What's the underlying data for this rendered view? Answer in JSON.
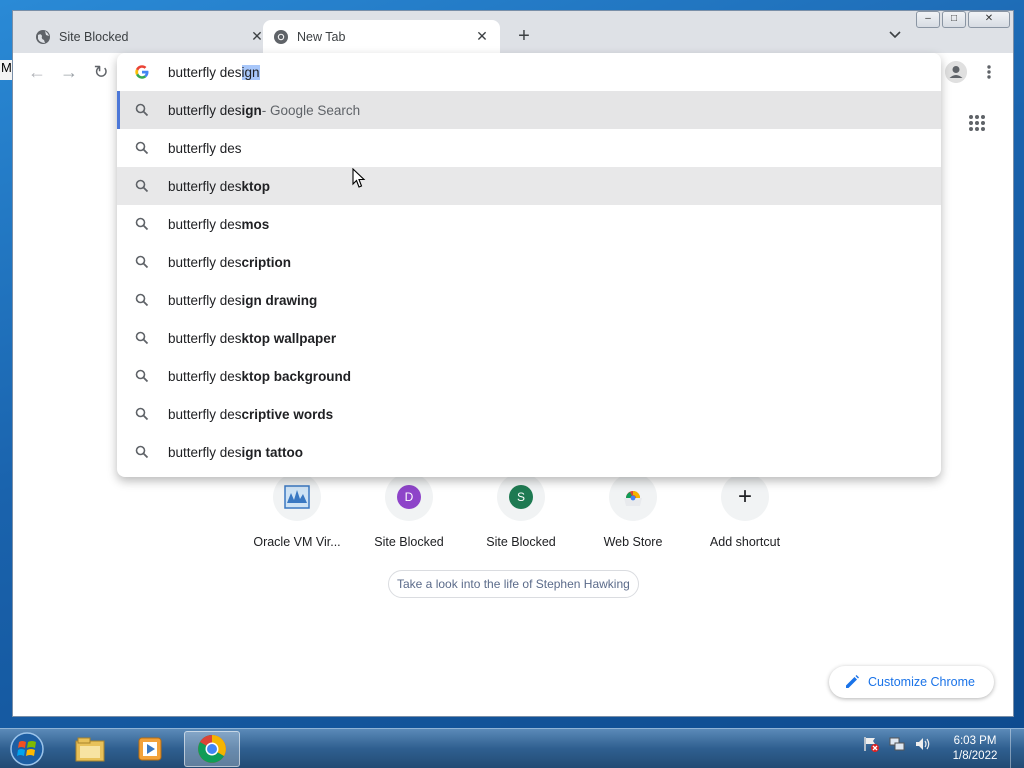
{
  "desktop": {
    "edge_letter": "M"
  },
  "tabs": [
    {
      "title": "Site Blocked",
      "icon": "globe-icon",
      "close": "✕"
    },
    {
      "title": "New Tab",
      "icon": "chrome-icon",
      "close": "✕"
    }
  ],
  "tabstrip": {
    "new_tab": "+",
    "window_controls": [
      "–",
      "□",
      "✕"
    ]
  },
  "toolbar": {
    "back": "←",
    "forward": "→",
    "reload": "↻"
  },
  "omnibox": {
    "typed": "butterfly des",
    "autocomplete_selected": "ign",
    "suggestions": [
      {
        "prefix": "butterfly des",
        "bold": "ign",
        "suffix": " - Google Search"
      },
      {
        "prefix": "butterfly des",
        "bold": "",
        "suffix": ""
      },
      {
        "prefix": "butterfly des",
        "bold": "ktop",
        "suffix": ""
      },
      {
        "prefix": "butterfly des",
        "bold": "mos",
        "suffix": ""
      },
      {
        "prefix": "butterfly des",
        "bold": "cription",
        "suffix": ""
      },
      {
        "prefix": "butterfly des",
        "bold": "ign drawing",
        "suffix": ""
      },
      {
        "prefix": "butterfly des",
        "bold": "ktop wallpaper",
        "suffix": ""
      },
      {
        "prefix": "butterfly des",
        "bold": "ktop background",
        "suffix": ""
      },
      {
        "prefix": "butterfly des",
        "bold": "criptive words",
        "suffix": ""
      },
      {
        "prefix": "butterfly des",
        "bold": "ign tattoo",
        "suffix": ""
      }
    ]
  },
  "shortcuts": [
    {
      "label": "Oracle VM Vir...",
      "icon": "virtualbox-icon",
      "letter": "",
      "color": ""
    },
    {
      "label": "Site Blocked",
      "icon": "letter-d-icon",
      "letter": "D",
      "color": "#8e44c9"
    },
    {
      "label": "Site Blocked",
      "icon": "letter-s-icon",
      "letter": "S",
      "color": "#1e7a52"
    },
    {
      "label": "Web Store",
      "icon": "webstore-icon",
      "letter": "",
      "color": ""
    },
    {
      "label": "Add shortcut",
      "icon": "plus-icon",
      "letter": "+",
      "color": ""
    }
  ],
  "promo": {
    "text": "Take a look into the life of Stephen Hawking"
  },
  "customize": {
    "label": "Customize Chrome"
  },
  "taskbar": {
    "items": [
      "file-explorer-icon",
      "media-player-icon",
      "chrome-icon"
    ],
    "clock_time": "6:03 PM",
    "clock_date": "1/8/2022"
  },
  "colors": {
    "accent": "#1a73e8",
    "selection": "#a8c7fa",
    "taskbar": "#2f5f90"
  }
}
